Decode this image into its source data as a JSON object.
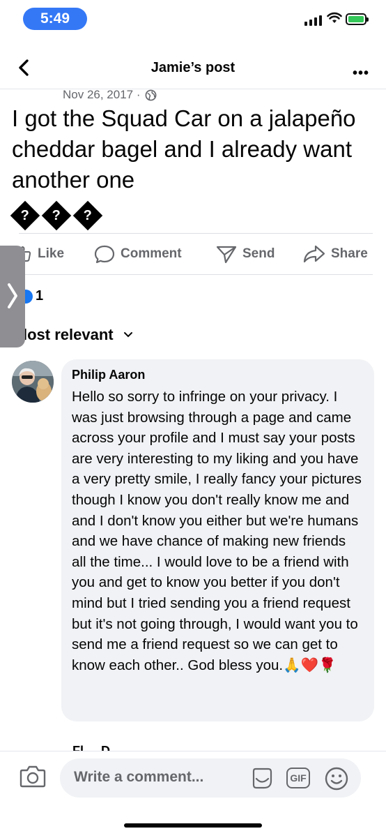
{
  "status": {
    "time": "5:49"
  },
  "nav": {
    "title": "Jamie’s post"
  },
  "post": {
    "date": "Nov 26, 2017 ·",
    "text": "I got the Squad Car on a jalapeño cheddar bagel and I already want another one",
    "emoji_glyphs": [
      "?",
      "?",
      "?"
    ]
  },
  "actions": {
    "like": "Like",
    "comment": "Comment",
    "send": "Send",
    "share": "Share"
  },
  "reactions": {
    "count": "1"
  },
  "sort": {
    "label": "lost relevant"
  },
  "comment": {
    "author": "Philip Aaron",
    "text": "Hello so sorry to infringe on your privacy. I was just browsing through a page and came across your profile and I must say your posts are very interesting to my liking and you have a very pretty smile, I really fancy your pictures though I know you don't really know me and and I don't know you either but we're humans and we have chance of making new friends all the time... I would love to be a friend with you and get to know you better if you don't mind but I tried sending you a friend request but it's not going through, I would want you to send me a friend request so we can get to know each other.. God bless you.🙏❤️🌹",
    "next_author_partial": "Fl  ...  D  ..."
  },
  "composer": {
    "placeholder": "Write a comment...",
    "gif": "GIF"
  },
  "colors": {
    "accent": "#3478f6",
    "facebook_blue": "#1877f2",
    "bubble": "#f0f2f5",
    "muted": "#65676b"
  },
  "icons": [
    "back-chevron-icon",
    "more-icon",
    "globe-icon",
    "like-icon",
    "comment-icon",
    "send-icon",
    "share-icon",
    "chevron-down-icon",
    "camera-icon",
    "sticker-icon",
    "gif-icon",
    "smile-icon"
  ]
}
